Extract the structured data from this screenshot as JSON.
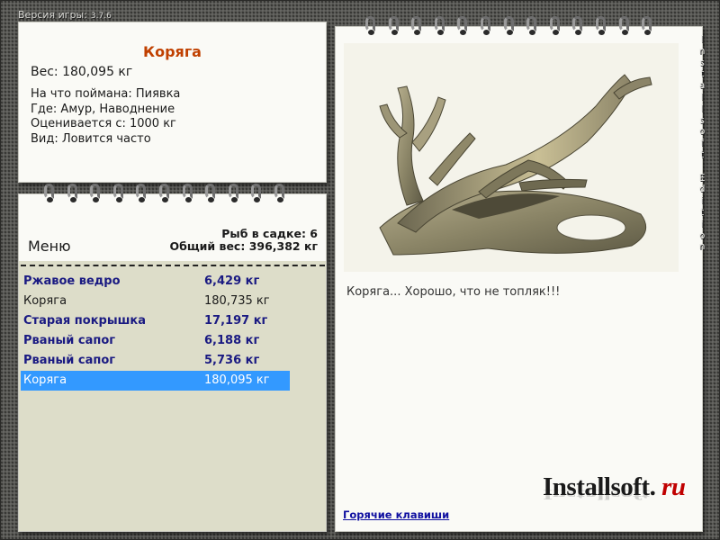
{
  "version": {
    "label": "Версия игры:",
    "number": "3.7.6"
  },
  "info": {
    "title": "Коряга",
    "weight": "Вес: 180,095 кг",
    "lines": [
      "На что поймана: Пиявка",
      "Где: Амур, Наводнение",
      "Оценивается с: 1000 кг",
      "Вид: Ловится часто"
    ]
  },
  "menu": {
    "title": "Меню",
    "count_label": "Рыб в садке: 6",
    "total_label": "Общий вес: 396,382 кг",
    "items": [
      {
        "name": "Ржавое ведро",
        "weight": "6,429 кг",
        "bold": true,
        "selected": false
      },
      {
        "name": "Коряга",
        "weight": "180,735 кг",
        "bold": false,
        "selected": false
      },
      {
        "name": "Старая покрышка",
        "weight": "17,197 кг",
        "bold": true,
        "selected": false
      },
      {
        "name": "Рваный сапог",
        "weight": "6,188 кг",
        "bold": true,
        "selected": false
      },
      {
        "name": "Рваный сапог",
        "weight": "5,736 кг",
        "bold": true,
        "selected": false
      },
      {
        "name": "Коряга",
        "weight": "180,095 кг",
        "bold": false,
        "selected": true
      }
    ]
  },
  "detail": {
    "caption": "Коряга... Хорошо, что не топляк!!!",
    "hotkeys_link": "Горячие клавиши",
    "logo_main": "Installsoft",
    "logo_dot": ".",
    "logo_tld": "ru"
  },
  "watermark_vertical": "Installsoft Edition",
  "colors": {
    "title_accent": "#c04000",
    "selection": "#3399ff",
    "bold_item": "#1a1a82",
    "link": "#1010a0",
    "logo_accent": "#c00000"
  }
}
